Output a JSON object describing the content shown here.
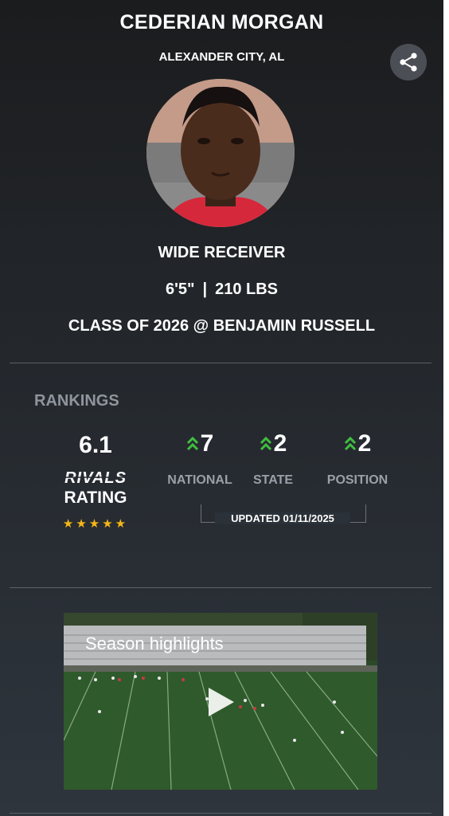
{
  "player": {
    "name": "CEDERIAN MORGAN",
    "hometown": "ALEXANDER CITY, AL",
    "position": "WIDE RECEIVER",
    "height": "6'5\"",
    "separator": "|",
    "weight": "210 LBS",
    "class_line": "CLASS OF 2026 @ BENJAMIN RUSSELL"
  },
  "rankings": {
    "title": "RANKINGS",
    "rating_value": "6.1",
    "rating_brand": "RIVALS",
    "rating_label": "RATING",
    "stars": 5,
    "stars_text": "★★★★★",
    "national": {
      "value": "7",
      "label": "NATIONAL"
    },
    "state": {
      "value": "2",
      "label": "STATE"
    },
    "position": {
      "value": "2",
      "label": "POSITION"
    },
    "updated": "UPDATED 01/11/2025"
  },
  "video": {
    "title": "Season highlights"
  },
  "colors": {
    "star": "#f5b616",
    "trend_up": "#3fbf3f",
    "muted_label": "#9aa0a6"
  },
  "icons": [
    "share-icon",
    "chevron-double-up-icon",
    "star-icon",
    "play-icon"
  ]
}
